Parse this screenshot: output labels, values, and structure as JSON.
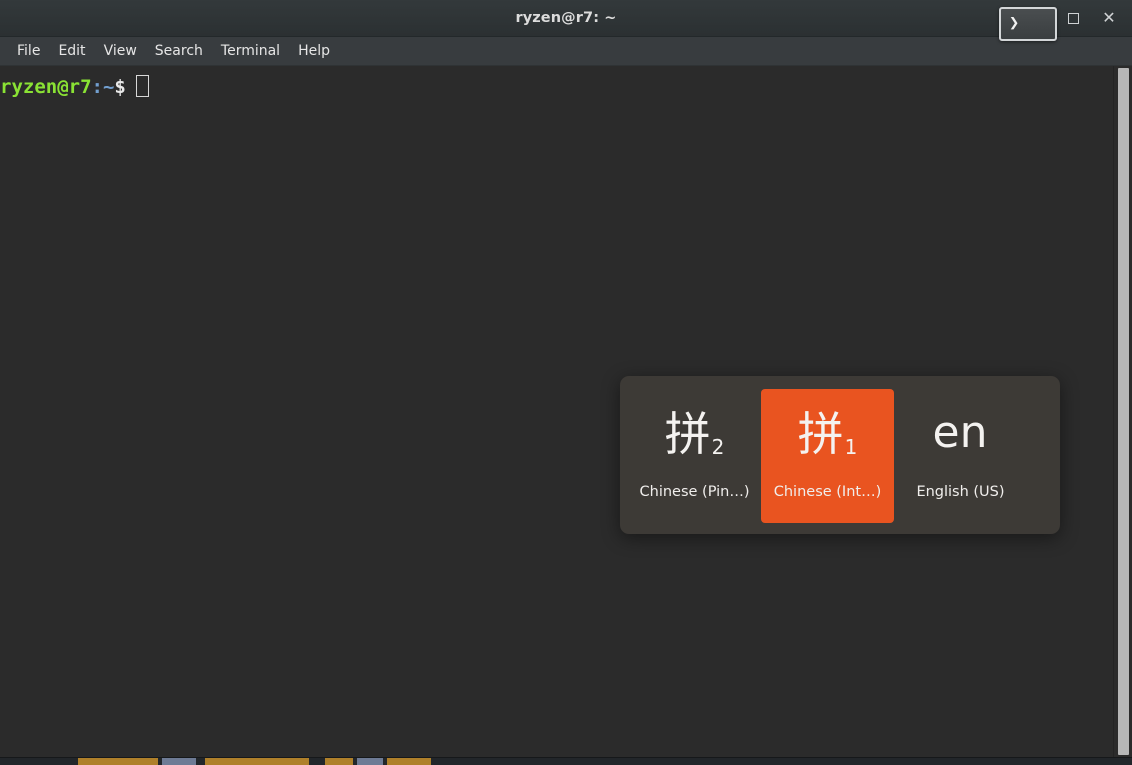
{
  "window": {
    "title": "ryzen@r7: ~",
    "controls": {
      "maximize_label": "Maximize",
      "close_label": "Close"
    },
    "app_icon": {
      "name": "terminal-prompt-icon",
      "glyph": "❯"
    }
  },
  "menubar": {
    "items": [
      {
        "label": "File"
      },
      {
        "label": "Edit"
      },
      {
        "label": "View"
      },
      {
        "label": "Search"
      },
      {
        "label": "Terminal"
      },
      {
        "label": "Help"
      }
    ]
  },
  "terminal": {
    "prompt": {
      "user_host": "ryzen@r7",
      "separator": ":",
      "path": "~",
      "sigil": "$",
      "command": ""
    },
    "colors": {
      "background": "#2b2b2b",
      "user_host": "#8ae234",
      "path": "#729fcf",
      "sigil": "#e8e8e8",
      "cursor": "#d8d8d8"
    }
  },
  "scrollbar": {
    "name": "terminal-vertical-scrollbar",
    "thumb_color": "#b7b7b7"
  },
  "ime_switcher": {
    "panel_color": "#3d3a36",
    "highlight_color": "#e95420",
    "engines": [
      {
        "glyph": "拼",
        "subscript": "2",
        "label": "Chinese (Pin…)",
        "selected": false,
        "icon_name": "pinyin-2-icon"
      },
      {
        "glyph": "拼",
        "subscript": "1",
        "label": "Chinese (Int…)",
        "selected": true,
        "icon_name": "pinyin-1-icon"
      },
      {
        "glyph": "en",
        "subscript": "",
        "label": "English (US)",
        "selected": false,
        "icon_name": "english-us-icon"
      }
    ]
  },
  "background_window": {
    "visible_strip": true
  }
}
